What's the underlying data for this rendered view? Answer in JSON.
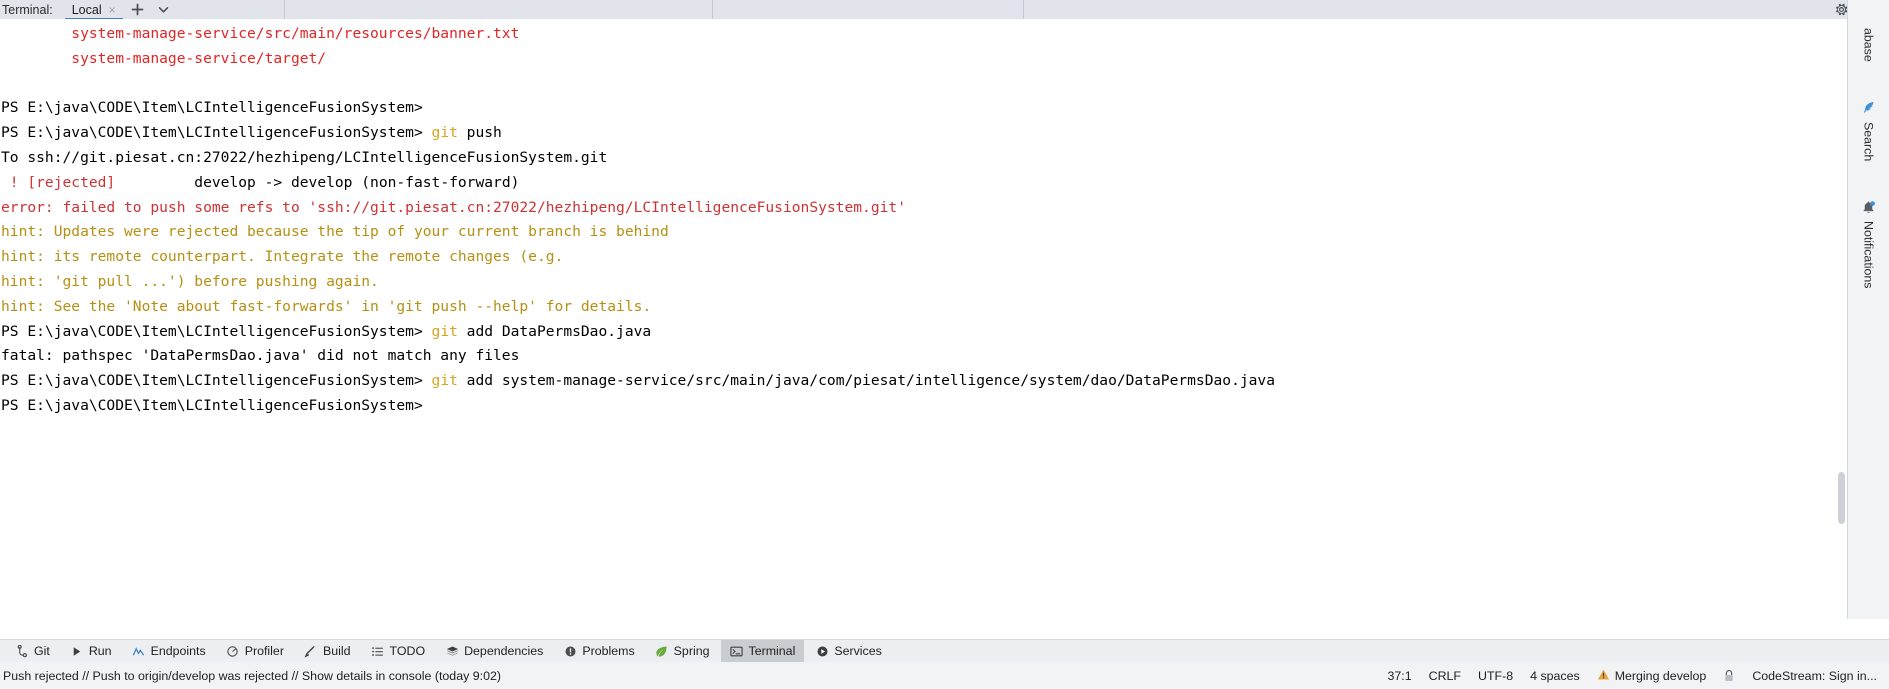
{
  "tabbar": {
    "label": "Terminal:",
    "tabs": [
      {
        "name": "Local",
        "close": "×",
        "active": true
      }
    ],
    "add_tooltip": "+",
    "dropdown_tooltip": "⌄",
    "settings_icon": "gear-icon",
    "minimize_icon": "minimize-icon"
  },
  "terminal": {
    "lines": [
      {
        "segments": [
          {
            "text": "        system-manage-service/src/main/resources/banner.txt",
            "color": "red"
          }
        ]
      },
      {
        "segments": [
          {
            "text": "        system-manage-service/target/",
            "color": "red"
          }
        ]
      },
      {
        "segments": [
          {
            "text": "",
            "color": "black"
          }
        ]
      },
      {
        "segments": [
          {
            "text": "PS E:\\java\\CODE\\Item\\LCIntelligenceFusionSystem>",
            "color": "black"
          }
        ]
      },
      {
        "segments": [
          {
            "text": "PS E:\\java\\CODE\\Item\\LCIntelligenceFusionSystem> ",
            "color": "black"
          },
          {
            "text": "git",
            "color": "gold"
          },
          {
            "text": " push",
            "color": "black"
          }
        ]
      },
      {
        "segments": [
          {
            "text": "To ssh://git.piesat.cn:27022/hezhipeng/LCIntelligenceFusionSystem.git",
            "color": "black"
          }
        ]
      },
      {
        "segments": [
          {
            "text": " ! [rejected]",
            "color": "crimson"
          },
          {
            "text": "         develop -> develop (non-fast-forward)",
            "color": "black"
          }
        ]
      },
      {
        "segments": [
          {
            "text": "error: failed to push some refs to 'ssh://git.piesat.cn:27022/hezhipeng/LCIntelligenceFusionSystem.git'",
            "color": "crimson"
          }
        ]
      },
      {
        "segments": [
          {
            "text": "hint: Updates were rejected because the tip of your current branch is behind",
            "color": "olive"
          }
        ]
      },
      {
        "segments": [
          {
            "text": "hint: its remote counterpart. Integrate the remote changes (e.g.",
            "color": "olive"
          }
        ]
      },
      {
        "segments": [
          {
            "text": "hint: 'git pull ...') before pushing again.",
            "color": "olive"
          }
        ]
      },
      {
        "segments": [
          {
            "text": "hint: See the 'Note about fast-forwards' in 'git push --help' for details.",
            "color": "olive"
          }
        ]
      },
      {
        "segments": [
          {
            "text": "PS E:\\java\\CODE\\Item\\LCIntelligenceFusionSystem> ",
            "color": "black"
          },
          {
            "text": "git",
            "color": "gold"
          },
          {
            "text": " add DataPermsDao.java",
            "color": "black"
          }
        ]
      },
      {
        "segments": [
          {
            "text": "fatal: pathspec 'DataPermsDao.java' did not match any files",
            "color": "black"
          }
        ]
      },
      {
        "segments": [
          {
            "text": "PS E:\\java\\CODE\\Item\\LCIntelligenceFusionSystem> ",
            "color": "black"
          },
          {
            "text": "git",
            "color": "gold"
          },
          {
            "text": " add system-manage-service/src/main/java/com/piesat/intelligence/system/dao/DataPermsDao.java",
            "color": "black"
          }
        ]
      },
      {
        "segments": [
          {
            "text": "PS E:\\java\\CODE\\Item\\LCIntelligenceFusionSystem>",
            "color": "black"
          }
        ]
      }
    ]
  },
  "right_strip": {
    "items": [
      {
        "label": "abase",
        "icon": "database-icon",
        "has_icon": false
      },
      {
        "label": "Search",
        "icon": "search-feather-icon",
        "has_icon": true
      },
      {
        "label": "Notifications",
        "icon": "bell-icon",
        "has_icon": true,
        "badge": true
      }
    ]
  },
  "tool_window_bar": {
    "items": [
      {
        "label": "Git",
        "icon": "git-branch-icon",
        "active": false
      },
      {
        "label": "Run",
        "icon": "play-icon",
        "active": false
      },
      {
        "label": "Endpoints",
        "icon": "endpoints-icon",
        "active": false
      },
      {
        "label": "Profiler",
        "icon": "profiler-icon",
        "active": false
      },
      {
        "label": "Build",
        "icon": "hammer-icon",
        "active": false
      },
      {
        "label": "TODO",
        "icon": "todo-list-icon",
        "active": false
      },
      {
        "label": "Dependencies",
        "icon": "dependencies-icon",
        "active": false
      },
      {
        "label": "Problems",
        "icon": "problems-icon",
        "active": false
      },
      {
        "label": "Spring",
        "icon": "spring-leaf-icon",
        "active": false
      },
      {
        "label": "Terminal",
        "icon": "terminal-icon",
        "active": true
      },
      {
        "label": "Services",
        "icon": "services-icon",
        "active": false
      }
    ]
  },
  "status_bar": {
    "message": "Push rejected // Push to origin/develop was rejected // Show details in console (today 9:02)",
    "caret_position": "37:1",
    "line_separator": "CRLF",
    "encoding": "UTF-8",
    "indent": "4 spaces",
    "branch": "Merging develop",
    "branch_icon": "warning-triangle-icon",
    "lock_icon": "lock-icon",
    "codestream": "CodeStream: Sign in..."
  },
  "colors": {
    "accent": "#4083c9",
    "error_red": "#cc3333",
    "path_red": "#e02525",
    "hint_olive": "#b59013",
    "keyword_gold": "#d6a61e",
    "tabbar_bg": "#e1e4ea",
    "statusbar_bg": "#f2f3f5"
  }
}
